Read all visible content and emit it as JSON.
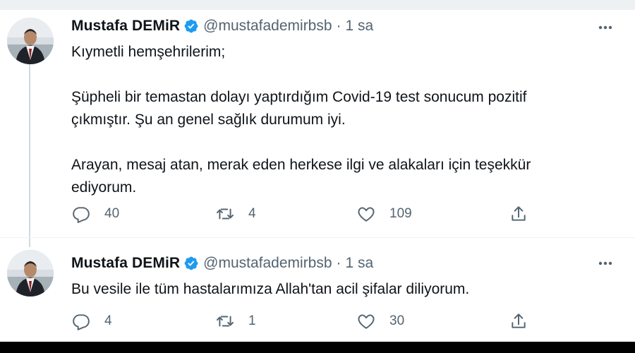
{
  "tweets": [
    {
      "author": {
        "name": "Mustafa DEMiR",
        "handle": "@mustafademirbsb"
      },
      "separator": "·",
      "time": "1 sa",
      "body": [
        "Kıymetli hemşehrilerim;",
        "",
        "Şüpheli bir temastan dolayı yaptırdığım Covid-19 test sonucum pozitif",
        "çıkmıştır. Şu an genel sağlık durumum iyi.",
        "",
        "Arayan, mesaj atan, merak eden herkese ilgi ve alakaları için teşekkür",
        "ediyorum."
      ],
      "stats": {
        "replies": "40",
        "retweets": "4",
        "likes": "109"
      }
    },
    {
      "author": {
        "name": "Mustafa DEMiR",
        "handle": "@mustafademirbsb"
      },
      "separator": "·",
      "time": "1 sa",
      "body": [
        "Bu vesile ile tüm hastalarımıza Allah'tan acil şifalar diliyorum."
      ],
      "stats": {
        "replies": "4",
        "retweets": "1",
        "likes": "30"
      }
    }
  ],
  "icons": {
    "verified": "verified-badge-icon",
    "more": "more-options-icon",
    "reply": "reply-icon",
    "retweet": "retweet-icon",
    "like": "like-icon",
    "share": "share-icon"
  },
  "colors": {
    "verified": "#1d9bf0",
    "text": "#0f1419",
    "muted": "#536471",
    "thread_line": "#cfd9de"
  }
}
